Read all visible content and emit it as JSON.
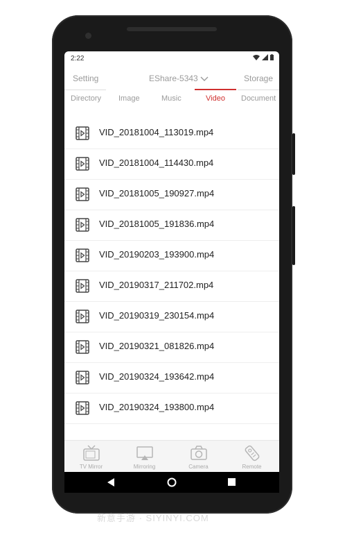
{
  "status": {
    "time": "2:22"
  },
  "header": {
    "setting_label": "Setting",
    "device_name": "EShare-5343",
    "storage_label": "Storage"
  },
  "tabs": [
    {
      "label": "Directory",
      "active": false
    },
    {
      "label": "Image",
      "active": false
    },
    {
      "label": "Music",
      "active": false
    },
    {
      "label": "Video",
      "active": true
    },
    {
      "label": "Document",
      "active": false
    }
  ],
  "files": [
    "VID_20181004_113019.mp4",
    "VID_20181004_114430.mp4",
    "VID_20181005_190927.mp4",
    "VID_20181005_191836.mp4",
    "VID_20190203_193900.mp4",
    "VID_20190317_211702.mp4",
    "VID_20190319_230154.mp4",
    "VID_20190321_081826.mp4",
    "VID_20190324_193642.mp4",
    "VID_20190324_193800.mp4"
  ],
  "bottom_nav": [
    {
      "label": "TV Mirror",
      "icon": "tv-icon"
    },
    {
      "label": "Mirroring",
      "icon": "airplay-icon"
    },
    {
      "label": "Camera",
      "icon": "camera-icon"
    },
    {
      "label": "Remote",
      "icon": "remote-icon"
    }
  ],
  "watermark": "新意手游 · SIYINYI.COM",
  "colors": {
    "accent": "#d0302f",
    "text_muted": "#9a9a9a"
  }
}
